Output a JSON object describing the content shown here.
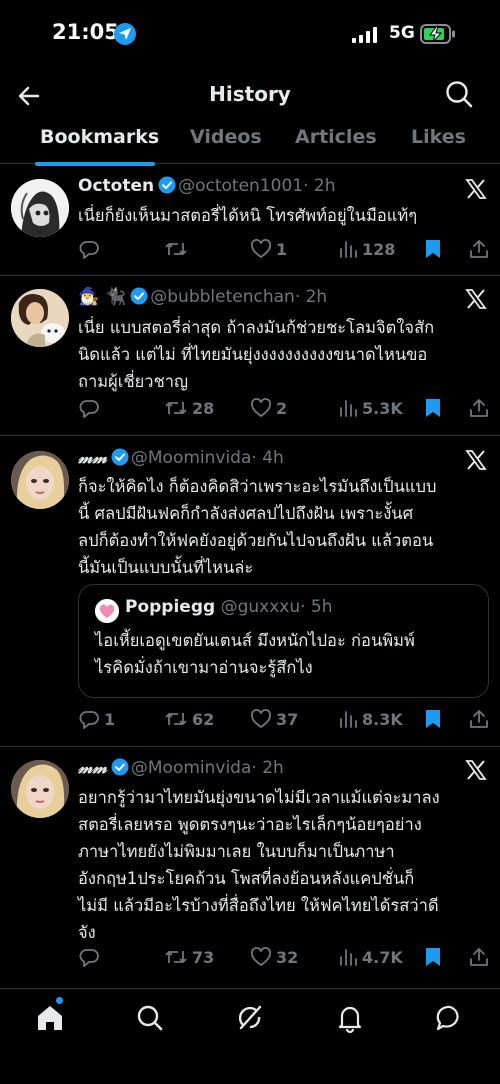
{
  "status_bar": {
    "time": "21:05",
    "network": "5G",
    "icons": [
      "location-icon",
      "signal-icon",
      "battery-charging-icon"
    ]
  },
  "header": {
    "title": "History",
    "back_icon": "back-arrow-icon",
    "search_icon": "search-icon"
  },
  "tabs": [
    {
      "label": "Bookmarks",
      "active": true
    },
    {
      "label": "Videos",
      "active": false
    },
    {
      "label": "Articles",
      "active": false
    },
    {
      "label": "Likes",
      "active": false
    }
  ],
  "colors": {
    "accent": "#1d9bf0",
    "muted": "#71767b",
    "text": "#e7e9ea",
    "divider": "#2f3336",
    "background": "#000000"
  },
  "tweets": [
    {
      "name": "Octoten",
      "handle": "@octoten1001",
      "time": "· 2h",
      "lines": [
        "เนี่ยก็ยังเห็นมาสตอรี่ได้หนิ โทรศัพท์อยู่ในมือแท้ๆ"
      ],
      "replies": "",
      "retweets": "",
      "likes": "1",
      "views": "128"
    },
    {
      "name": "🧙‍♂️ 🐈‍⬛",
      "handle": "@bubbletenchan",
      "time": "· 2h",
      "lines": [
        "เนี่ย แบบสตอรี่ล่าสุด ถ้าลงมันก้ช่วยชะโลมจิตใจสัก",
        "นิดแล้ว แต่ไม่ ที่ไทยมันยุ่งงงงงงงงงงขนาดไหนขอ",
        "ถามผู้เชี่ยวชาญ"
      ],
      "replies": "",
      "retweets": "28",
      "likes": "2",
      "views": "5.3K"
    },
    {
      "name": "𝓂𝓂",
      "handle": "@Moominvida",
      "time": "· 4h",
      "lines": [
        "ก็จะให้คิดไง ก็ต้องคิดสิว่าเพราะอะไรมันถึงเป็นแบบ",
        "นี้ ศลปมีฝันฟคก็กำลังส่งศลปไปถึงฝัน เพราะงั้นศ",
        "ลปก็ต้องทำให้ฟคยังอยู่ด้วยกันไปจนถึงฝัน แล้วตอน",
        "นี้มันเป็นแบบนั้นที่ไหนล่ะ"
      ],
      "quote": {
        "name": "Poppiegg",
        "handle": "@guxxxu",
        "time": "· 5h",
        "lines": [
          "ไอเหี้ยเอดูเขตยันเตนส์ มึงหนักไปอะ ก่อนพิมพ์",
          "ไรคิดมั่งถ้าเขามาอ่านจะรู้สึกไง"
        ]
      },
      "replies": "1",
      "retweets": "62",
      "likes": "37",
      "views": "8.3K"
    },
    {
      "name": "𝓂𝓂",
      "handle": "@Moominvida",
      "time": "· 2h",
      "lines": [
        "อยากรู้ว่ามาไทยมันยุ่งขนาดไม่มีเวลาแม้แต่จะมาลง",
        "สตอรี่เลยหรอ พูดตรงๆนะว่าอะไรเล็กๆน้อยๆอย่าง",
        "ภาษาไทยยังไม่พิมมาเลย ในบบก็มาเป็นภาษา",
        "อังกฤษ1ประโยคถ้วน โพสที่ลงย้อนหลังแคปชั่นก็",
        "ไม่มี แล้วมีอะไรบ้างที่สื่อถึงไทย ให้ฟคไทยได้รสว่าดี",
        "จัง"
      ],
      "replies": "",
      "retweets": "73",
      "likes": "32",
      "views": "4.7K"
    }
  ],
  "bottom_nav": [
    "home-icon",
    "search-icon",
    "grok-icon",
    "notifications-icon",
    "messages-icon"
  ]
}
